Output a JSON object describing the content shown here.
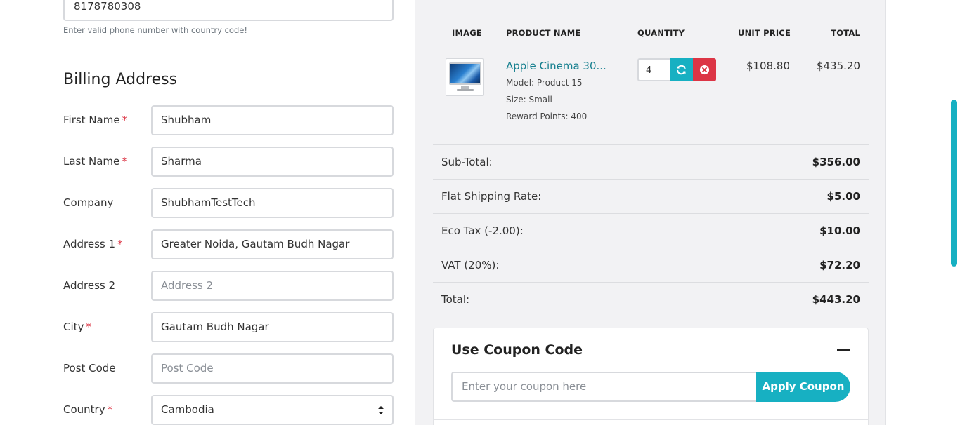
{
  "contact": {
    "phone_value": "8178780308",
    "phone_help": "Enter valid phone number with country code!"
  },
  "billing": {
    "title": "Billing Address",
    "required_marker": "*",
    "fields": [
      {
        "label": "First Name",
        "required": true,
        "value": "Shubham",
        "placeholder": ""
      },
      {
        "label": "Last Name",
        "required": true,
        "value": "Sharma",
        "placeholder": ""
      },
      {
        "label": "Company",
        "required": false,
        "value": "ShubhamTestTech",
        "placeholder": ""
      },
      {
        "label": "Address 1",
        "required": true,
        "value": "Greater Noida, Gautam Budh Nagar",
        "placeholder": ""
      },
      {
        "label": "Address 2",
        "required": false,
        "value": "",
        "placeholder": "Address 2"
      },
      {
        "label": "City",
        "required": true,
        "value": "Gautam Budh Nagar",
        "placeholder": ""
      },
      {
        "label": "Post Code",
        "required": false,
        "value": "",
        "placeholder": "Post Code"
      },
      {
        "label": "Country",
        "required": true,
        "value": "Cambodia",
        "placeholder": ""
      }
    ]
  },
  "cart": {
    "headers": {
      "image": "IMAGE",
      "product_name": "PRODUCT NAME",
      "quantity": "QUANTITY",
      "unit_price": "UNIT PRICE",
      "total": "TOTAL"
    },
    "items": [
      {
        "name": "Apple Cinema 30...",
        "model": "Model: Product 15",
        "size": "Size: Small",
        "reward": "Reward Points: 400",
        "quantity": "4",
        "unit_price": "$108.80",
        "total": "$435.20",
        "image_icon": "monitor-image"
      }
    ],
    "summary": [
      {
        "label": "Sub-Total:",
        "value": "$356.00"
      },
      {
        "label": "Flat Shipping Rate:",
        "value": "$5.00"
      },
      {
        "label": "Eco Tax (-2.00):",
        "value": "$10.00"
      },
      {
        "label": "VAT (20%):",
        "value": "$72.20"
      },
      {
        "label": "Total:",
        "value": "$443.20"
      }
    ]
  },
  "coupon": {
    "title": "Use Coupon Code",
    "placeholder": "Enter your coupon here",
    "button_label": "Apply Coupon",
    "collapse_icon": "minus-icon"
  },
  "colors": {
    "accent": "#17b0c2",
    "danger": "#dc3545",
    "link": "#17808f",
    "panel_bg": "#f2f2f4"
  }
}
